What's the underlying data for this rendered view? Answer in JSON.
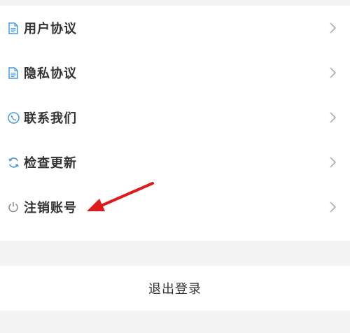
{
  "menu": {
    "items": [
      {
        "label": "用户协议",
        "icon": "document-icon"
      },
      {
        "label": "隐私协议",
        "icon": "document-icon"
      },
      {
        "label": "联系我们",
        "icon": "phone-icon"
      },
      {
        "label": "检查更新",
        "icon": "refresh-icon"
      },
      {
        "label": "注销账号",
        "icon": "power-icon"
      }
    ]
  },
  "logout": {
    "label": "退出登录"
  },
  "colors": {
    "accent": "#4a9ad8",
    "muted_icon": "#888888",
    "text": "#333333",
    "chevron": "#aaaaaa",
    "annotation_arrow": "#e0191b"
  }
}
